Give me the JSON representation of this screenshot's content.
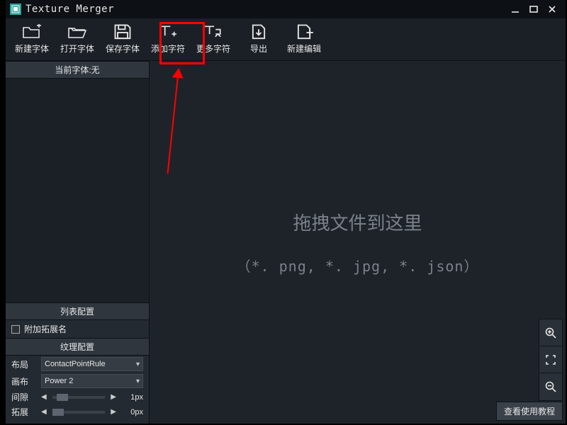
{
  "window": {
    "title": "Texture Merger"
  },
  "toolbar": {
    "new_font": "新建字体",
    "open_font": "打开字体",
    "save_font": "保存字体",
    "add_char": "添加字符",
    "more_char": "更多字符",
    "export": "导出",
    "new_edit": "新建编辑"
  },
  "sidebar": {
    "current_font_label": "当前字体:无",
    "list_config_title": "列表配置",
    "append_ext_label": "附加拓展名",
    "texture_config_title": "纹理配置",
    "layout_label": "布局",
    "layout_value": "ContactPointRule",
    "canvas_label": "画布",
    "canvas_value": "Power 2",
    "gap_label": "间隙",
    "gap_value": "1px",
    "extend_label": "拓展",
    "extend_value": "0px"
  },
  "canvas": {
    "drop_title": "拖拽文件到这里",
    "drop_hint": "（*. png, *. jpg, *. json）"
  },
  "footer": {
    "tutorial_button": "查看使用教程"
  }
}
